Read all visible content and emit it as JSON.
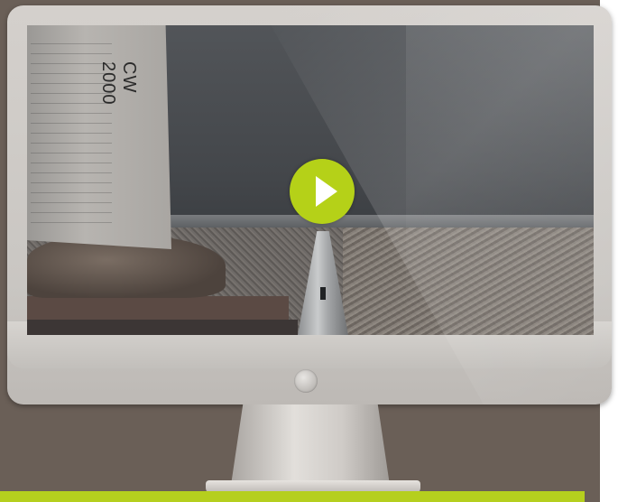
{
  "video": {
    "bag_text": "CW 2000",
    "play_icon": "play-icon"
  },
  "colors": {
    "accent": "#b5cf1e",
    "play": "#b5d118",
    "backdrop": "#6a5f57"
  }
}
